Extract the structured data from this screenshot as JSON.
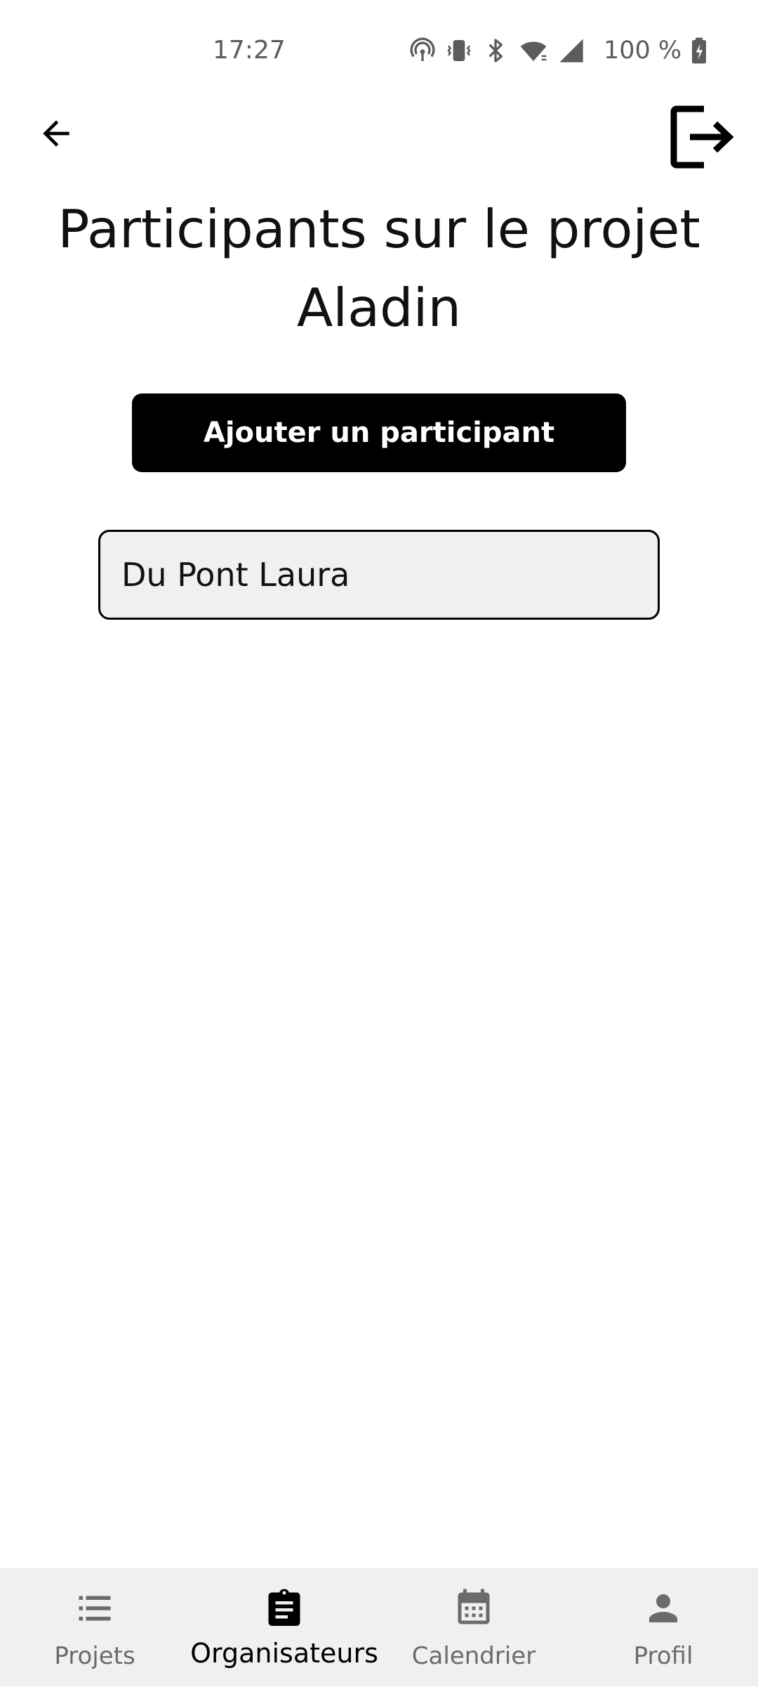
{
  "status_bar": {
    "time": "17:27",
    "battery": "100 %",
    "icons": [
      "hotspot-icon",
      "vibrate-icon",
      "bluetooth-icon",
      "wifi-icon",
      "signal-icon",
      "battery-charging-icon"
    ]
  },
  "top_bar": {
    "back_icon": "arrow-left-icon",
    "logout_icon": "logout-icon"
  },
  "page": {
    "title_line1": "Participants sur le projet",
    "title_line2": "Aladin",
    "add_button_label": "Ajouter un participant"
  },
  "participants": [
    {
      "name": "Du Pont Laura"
    }
  ],
  "bottom_nav": {
    "active": "Organisateurs",
    "items": [
      {
        "label": "Projets",
        "icon": "list-icon"
      },
      {
        "label": "Organisateurs",
        "icon": "clipboard-icon"
      },
      {
        "label": "Calendrier",
        "icon": "calendar-icon"
      },
      {
        "label": "Profil",
        "icon": "person-icon"
      }
    ]
  },
  "colors": {
    "background": "#ffffff",
    "primary": "#000000",
    "card_background": "#f0f0f0",
    "nav_background": "#f0f0f0",
    "inactive_nav": "#6b6b6b",
    "status_text": "#5c5c5c"
  }
}
